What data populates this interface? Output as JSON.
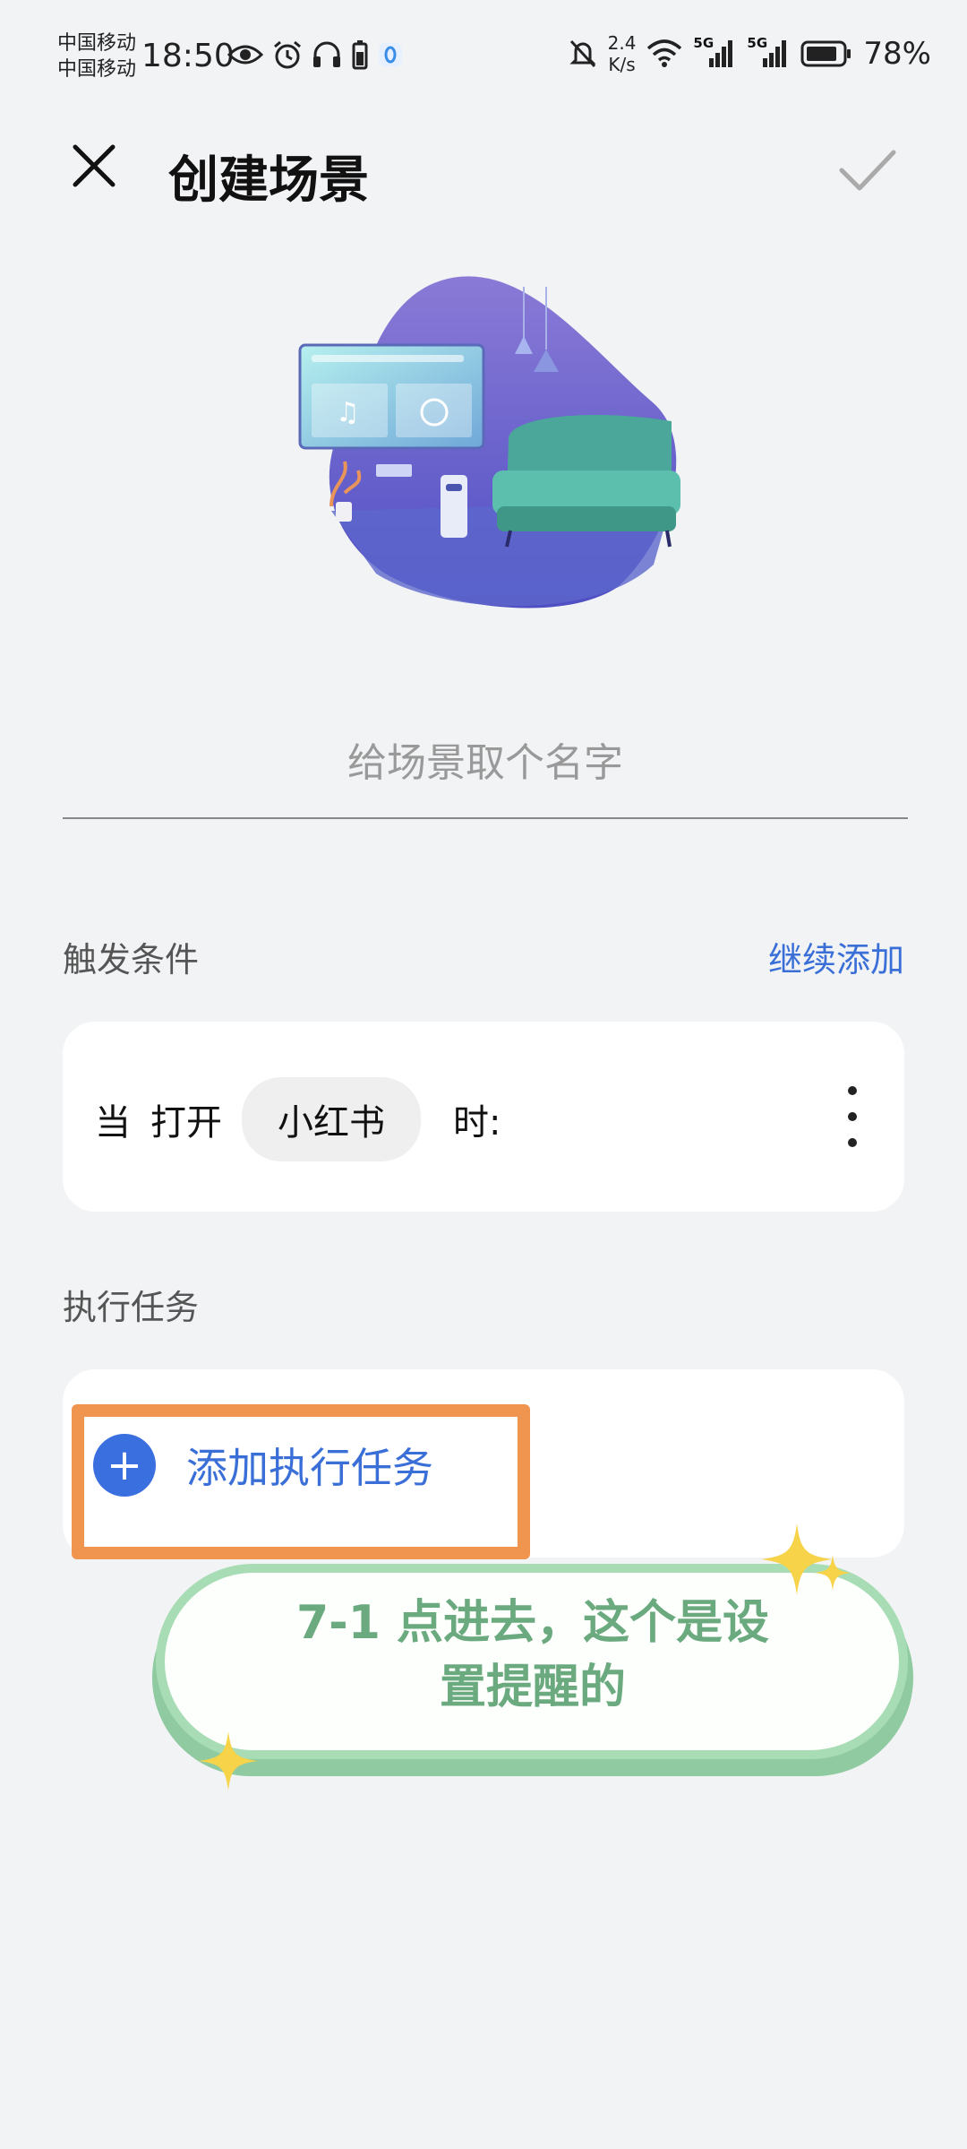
{
  "status_bar": {
    "carrier_1": "中国移动",
    "carrier_2": "中国移动",
    "time": "18:50",
    "net_speed_value": "2.4",
    "net_speed_unit": "K/s",
    "network_1": "5G",
    "network_2": "5G",
    "battery": "78%",
    "icons_left": [
      "eye-icon",
      "alarm-icon",
      "headphones-icon",
      "battery-saver-icon",
      "app-notification-icon"
    ],
    "icons_right": [
      "mute-icon",
      "wifi-icon",
      "signal-icon",
      "signal-icon",
      "battery-icon"
    ]
  },
  "header": {
    "title": "创建场景"
  },
  "name_input": {
    "placeholder": "给场景取个名字",
    "value": ""
  },
  "trigger": {
    "section_label": "触发条件",
    "add_more": "继续添加",
    "prefix_when": "当",
    "action": "打开",
    "app": "小红书",
    "suffix": "时:"
  },
  "tasks": {
    "section_label": "执行任务",
    "add_label": "添加执行任务",
    "add_icon": "+"
  },
  "annotation": {
    "line1": "7-1 点进去，这个是设",
    "line2": "置提醒的"
  },
  "colors": {
    "accent_blue": "#3a6fd8",
    "annotation_orange": "#ef9550",
    "bubble_green": "#a8dcb4",
    "sparkle_yellow": "#f7d34a"
  }
}
